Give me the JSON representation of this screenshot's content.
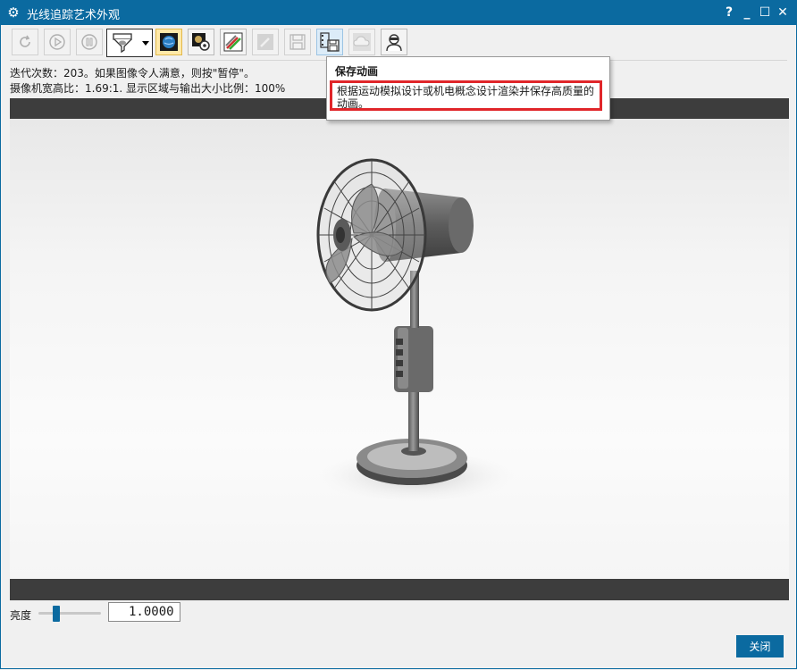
{
  "window": {
    "title": "光线追踪艺术外观",
    "help_label": "?",
    "minimize_label": "_",
    "maximize_label": "☐",
    "close_label": "✕"
  },
  "toolbar": {
    "buttons": [
      {
        "name": "restart",
        "icon": "refresh-icon",
        "enabled": false
      },
      {
        "name": "start",
        "icon": "play-icon",
        "enabled": false
      },
      {
        "name": "pause",
        "icon": "pause-icon",
        "enabled": false
      },
      {
        "name": "render-mode",
        "icon": "render-filter-icon",
        "enabled": true,
        "dropdown": true
      },
      {
        "name": "display-image",
        "icon": "globe-image-icon",
        "enabled": true,
        "active": true
      },
      {
        "name": "render-settings",
        "icon": "image-gear-icon",
        "enabled": true
      },
      {
        "name": "edit-materials",
        "icon": "pencils-icon",
        "enabled": true
      },
      {
        "name": "edit",
        "icon": "pencil-icon",
        "enabled": false
      },
      {
        "name": "save-image",
        "icon": "save-icon",
        "enabled": false
      },
      {
        "name": "save-animation",
        "icon": "film-save-icon",
        "enabled": true,
        "hover": true
      },
      {
        "name": "cloud",
        "icon": "cloud-icon",
        "enabled": false
      },
      {
        "name": "person",
        "icon": "person-icon",
        "enabled": true
      }
    ]
  },
  "status": {
    "iterations": "迭代次数：203。如果图像令人满意，则按\"暂停\"。",
    "camera_ratio": "摄像机宽高比：1.69:1. 显示区域与输出大小比例：100%"
  },
  "tooltip": {
    "title": "保存动画",
    "description": "根据运动模拟设计或机电概念设计渲染并保存高质量的动画。"
  },
  "brightness": {
    "label": "亮度",
    "value": "1.0000",
    "slider_fraction": 0.25
  },
  "footer": {
    "close_label": "关闭"
  },
  "colors": {
    "accent": "#0b6aa0",
    "highlight": "#e0262a"
  }
}
